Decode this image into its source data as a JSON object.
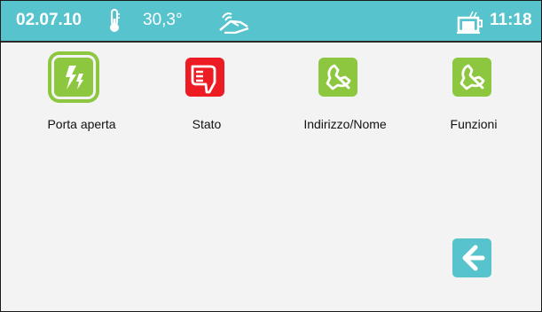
{
  "colors": {
    "header": "#57c3cd",
    "green": "#8dc63f",
    "red": "#ed1c24",
    "teal": "#57c3cd"
  },
  "header": {
    "date": "02.07.10",
    "temperature": "30,3°",
    "time": "11:18",
    "icons": [
      "thermometer-icon",
      "hand-touch-icon",
      "coffee-cup-icon"
    ]
  },
  "tiles": [
    {
      "label": "Porta aperta",
      "icon": "lightning-icon",
      "color": "green",
      "selected": true
    },
    {
      "label": "Stato",
      "icon": "thumbs-down-icon",
      "color": "red",
      "selected": false
    },
    {
      "label": "Indirizzo/Nome",
      "icon": "wrench-icon",
      "color": "green",
      "selected": false
    },
    {
      "label": "Funzioni",
      "icon": "wrench-icon",
      "color": "green",
      "selected": false
    }
  ],
  "back_button": {
    "icon": "arrow-left-icon"
  }
}
